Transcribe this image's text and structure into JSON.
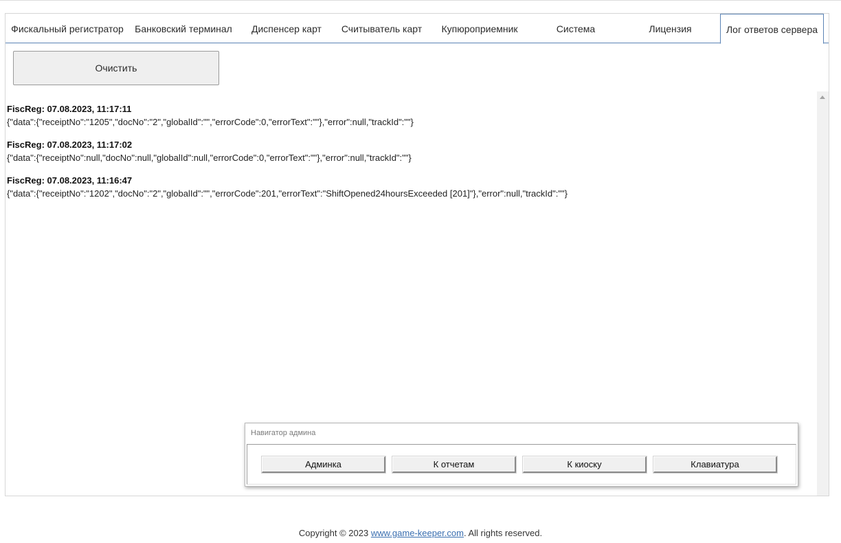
{
  "tabs": [
    {
      "label": "Фискальный регистратор"
    },
    {
      "label": "Банковский терминал"
    },
    {
      "label": "Диспенсер карт"
    },
    {
      "label": "Считыватель карт"
    },
    {
      "label": "Купюроприемник"
    },
    {
      "label": "Система"
    },
    {
      "label": "Лицензия"
    },
    {
      "label": "Лог ответов сервера",
      "active": true
    }
  ],
  "toolbar": {
    "clear_label": "Очистить"
  },
  "log": [
    {
      "header": "FiscReg: 07.08.2023, 11:17:11",
      "body": "{\"data\":{\"receiptNo\":\"1205\",\"docNo\":\"2\",\"globalId\":\"\",\"errorCode\":0,\"errorText\":\"\"},\"error\":null,\"trackId\":\"\"}"
    },
    {
      "header": "FiscReg: 07.08.2023, 11:17:02",
      "body": "{\"data\":{\"receiptNo\":null,\"docNo\":null,\"globalId\":null,\"errorCode\":0,\"errorText\":\"\"},\"error\":null,\"trackId\":\"\"}"
    },
    {
      "header": "FiscReg: 07.08.2023, 11:16:47",
      "body": "{\"data\":{\"receiptNo\":\"1202\",\"docNo\":\"2\",\"globalId\":\"\",\"errorCode\":201,\"errorText\":\"ShiftOpened24hoursExceeded [201]\"},\"error\":null,\"trackId\":\"\"}"
    }
  ],
  "admin_nav": {
    "title": "Навигатор админа",
    "buttons": [
      {
        "label": "Админка"
      },
      {
        "label": "К отчетам"
      },
      {
        "label": "К киоску"
      },
      {
        "label": "Клавиатура"
      }
    ]
  },
  "footer": {
    "prefix": "Copyright © 2023 ",
    "link": "www.game-keeper.com",
    "suffix": ". All rights reserved."
  },
  "colors": {
    "tab_border": "#5b83b5",
    "link": "#3a6fb0"
  }
}
